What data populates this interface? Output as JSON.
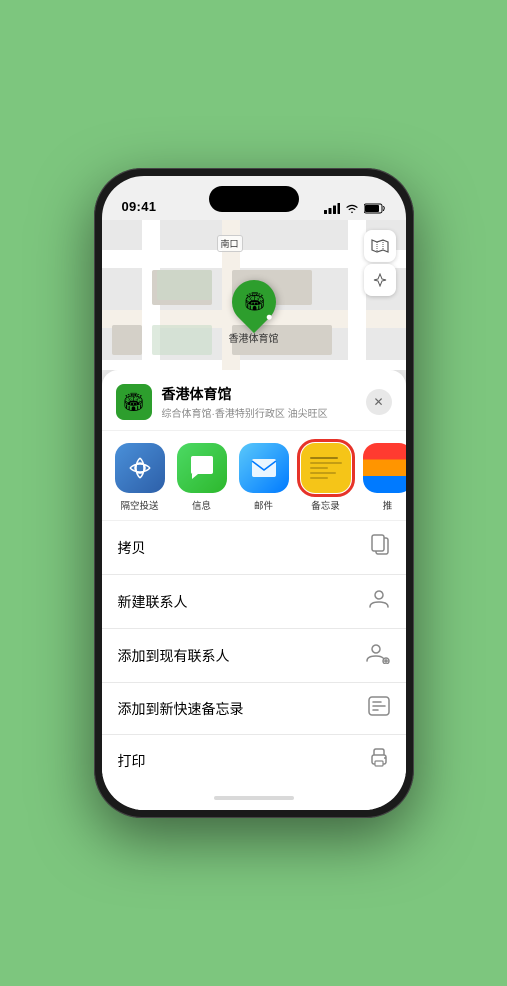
{
  "status_bar": {
    "time": "09:41",
    "location_icon": "▶"
  },
  "map": {
    "label": "南口",
    "controls": {
      "map_icon": "🗺",
      "compass_icon": "➤"
    }
  },
  "pin": {
    "label": "香港体育馆",
    "emoji": "🏟"
  },
  "venue": {
    "name": "香港体育馆",
    "subtitle": "综合体育馆·香港特别行政区 油尖旺区",
    "emoji": "🏟"
  },
  "share_items": [
    {
      "id": "airdrop",
      "label": "隔空投送",
      "type": "airdrop"
    },
    {
      "id": "message",
      "label": "信息",
      "type": "message"
    },
    {
      "id": "mail",
      "label": "邮件",
      "type": "mail"
    },
    {
      "id": "notes",
      "label": "备忘录",
      "type": "notes"
    },
    {
      "id": "more",
      "label": "推",
      "type": "more"
    }
  ],
  "actions": [
    {
      "id": "copy",
      "label": "拷贝",
      "icon": "📋"
    },
    {
      "id": "new-contact",
      "label": "新建联系人",
      "icon": "👤"
    },
    {
      "id": "add-to-contact",
      "label": "添加到现有联系人",
      "icon": "👥"
    },
    {
      "id": "add-to-notes",
      "label": "添加到新快速备忘录",
      "icon": "📝"
    },
    {
      "id": "print",
      "label": "打印",
      "icon": "🖨"
    }
  ]
}
